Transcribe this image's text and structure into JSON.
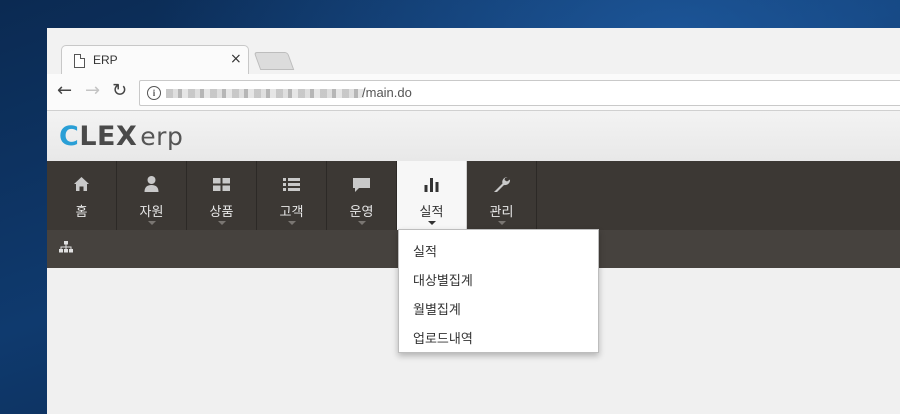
{
  "browser": {
    "tab_title": "ERP",
    "tab_close": "×",
    "url_visible": "/main.do",
    "back": "←",
    "forward": "→",
    "reload": "↻",
    "info": "i"
  },
  "app": {
    "logo_main": "LEX",
    "logo_c": "C",
    "logo_suffix": "erp"
  },
  "nav": {
    "items": [
      {
        "label": "홈",
        "icon": "home-icon"
      },
      {
        "label": "자원",
        "icon": "user-icon"
      },
      {
        "label": "상품",
        "icon": "grid-icon"
      },
      {
        "label": "고객",
        "icon": "list-icon"
      },
      {
        "label": "운영",
        "icon": "comment-icon"
      },
      {
        "label": "실적",
        "icon": "bar-chart-icon",
        "active": true
      },
      {
        "label": "관리",
        "icon": "wrench-icon"
      }
    ]
  },
  "dropdown": {
    "items": [
      "실적",
      "대상별집계",
      "월별집계",
      "업로드내역"
    ]
  },
  "colors": {
    "navbar": "#3c3834",
    "subbar": "#46423e",
    "logo_accent": "#2a9fd6"
  }
}
